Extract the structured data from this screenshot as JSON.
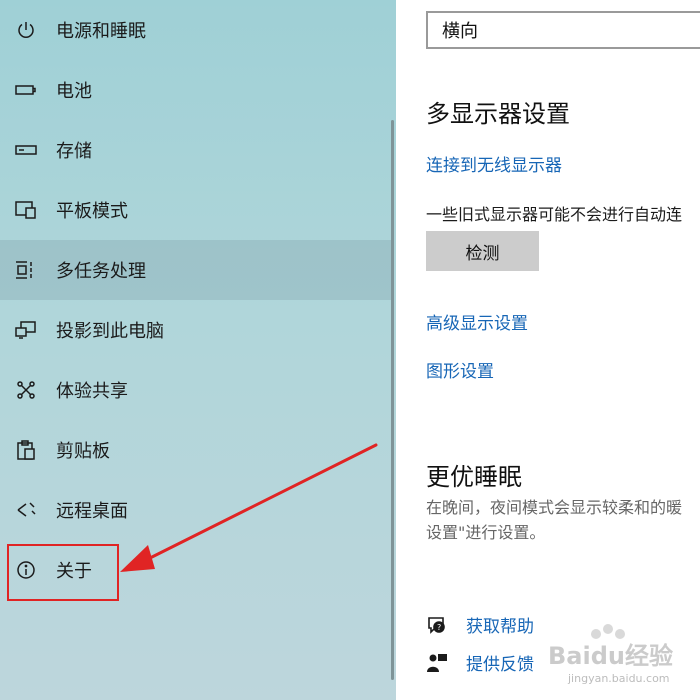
{
  "sidebar": {
    "items": [
      {
        "label": "电源和睡眠",
        "icon": "power-icon"
      },
      {
        "label": "电池",
        "icon": "battery-icon"
      },
      {
        "label": "存储",
        "icon": "storage-icon"
      },
      {
        "label": "平板模式",
        "icon": "tablet-mode-icon"
      },
      {
        "label": "多任务处理",
        "icon": "multitasking-icon",
        "active": true
      },
      {
        "label": "投影到此电脑",
        "icon": "projecting-icon"
      },
      {
        "label": "体验共享",
        "icon": "shared-experiences-icon"
      },
      {
        "label": "剪贴板",
        "icon": "clipboard-icon"
      },
      {
        "label": "远程桌面",
        "icon": "remote-desktop-icon"
      },
      {
        "label": "关于",
        "icon": "info-icon",
        "highlighted": true
      }
    ]
  },
  "content": {
    "orientation_value": "横向",
    "multi_display": {
      "title": "多显示器设置",
      "connect_wireless_link": "连接到无线显示器",
      "description": "一些旧式显示器可能不会进行自动连",
      "detect_button": "检测",
      "advanced_display_link": "高级显示设置",
      "graphics_link": "图形设置"
    },
    "better_sleep": {
      "title": "更优睡眠",
      "description_line1": "在晚间，夜间模式会显示较柔和的暖",
      "description_line2": "设置\"进行设置。"
    },
    "help": {
      "get_help": "获取帮助",
      "give_feedback": "提供反馈"
    }
  },
  "annotation": {
    "color": "#e02424"
  },
  "watermark": {
    "main": "Baidu经验",
    "sub": "jingyan.baidu.com"
  }
}
